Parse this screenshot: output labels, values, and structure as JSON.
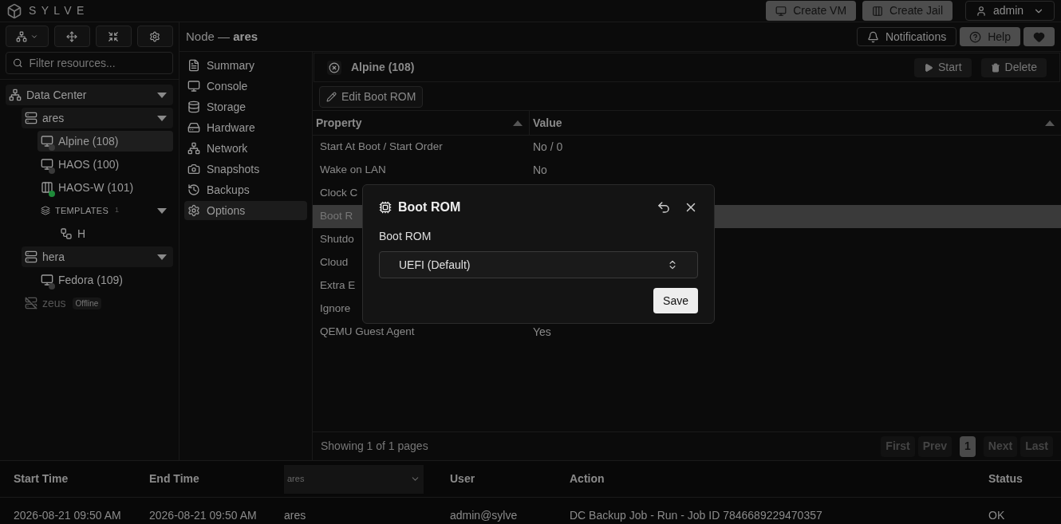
{
  "brand": "SYLVE",
  "header_buttons": [
    {
      "label": "Create VM",
      "kind": "vm"
    },
    {
      "label": "Create Jail",
      "kind": "jail"
    },
    {
      "label": "admin",
      "kind": "user"
    }
  ],
  "search": {
    "placeholder": "Filter resources..."
  },
  "tree": [
    {
      "label": "Data Center",
      "kind": "datacenter",
      "expanded": true,
      "children": [
        {
          "label": "ares",
          "kind": "node",
          "expanded": true,
          "children": [
            {
              "label": "Alpine (108)",
              "kind": "vm",
              "color": "#3a3a3a",
              "selected": true
            },
            {
              "label": "HAOS (100)",
              "kind": "vm",
              "color": "#3a3a3a",
              "selected": false
            },
            {
              "label": "HAOS-W (101)",
              "kind": "jail",
              "color": "#1f8a3a",
              "selected": false
            },
            {
              "label": "TEMPLATES",
              "count": "1",
              "kind": "group",
              "expanded": true,
              "children": [
                {
                  "label": "H",
                  "kind": "template",
                  "selected": false
                }
              ]
            }
          ]
        },
        {
          "label": "hera",
          "kind": "node",
          "expanded": true,
          "children": [
            {
              "label": "Fedora (109)",
              "kind": "vm",
              "color": "#3a3a3a",
              "selected": false
            }
          ]
        },
        {
          "label": "zeus",
          "kind": "offline",
          "badge": "Offline"
        }
      ]
    }
  ],
  "breadcrumb": {
    "prefix": "Node —",
    "node": "ares"
  },
  "top_right_buttons": [
    {
      "label": "Notifications",
      "kind": "bell"
    },
    {
      "label": "Help",
      "kind": "help"
    },
    {
      "kind": "heart"
    }
  ],
  "menu": [
    {
      "label": "Summary",
      "kind": "summary",
      "selected": false
    },
    {
      "label": "Console",
      "kind": "console",
      "selected": false
    },
    {
      "label": "Storage",
      "kind": "storage",
      "selected": false
    },
    {
      "label": "Hardware",
      "kind": "hardware",
      "selected": false
    },
    {
      "label": "Network",
      "kind": "network",
      "selected": false
    },
    {
      "label": "Snapshots",
      "kind": "snapshots",
      "selected": false
    },
    {
      "label": "Backups",
      "kind": "backups",
      "selected": false
    },
    {
      "label": "Options",
      "kind": "options",
      "selected": true
    }
  ],
  "vm_title": "Alpine (108)",
  "vm_actions": [
    {
      "label": "Start",
      "kind": "start"
    },
    {
      "label": "Delete",
      "kind": "delete"
    }
  ],
  "edit_button": "Edit Boot ROM",
  "table": {
    "columns": [
      "Property",
      "Value"
    ],
    "rows": [
      {
        "property": "Start At Boot / Start Order",
        "value": "No / 0",
        "selected": false
      },
      {
        "property": "Wake on LAN",
        "value": "No",
        "selected": false
      },
      {
        "property": "Clock C",
        "selected": false
      },
      {
        "property": "Boot R",
        "selected": true
      },
      {
        "property": "Shutdo",
        "selected": false
      },
      {
        "property": "Cloud",
        "selected": false
      },
      {
        "property": "Extra E",
        "selected": false
      },
      {
        "property": "Ignore",
        "selected": false
      },
      {
        "property": "QEMU Guest Agent",
        "value": "Yes",
        "selected": false
      }
    ]
  },
  "pagination": {
    "info": "Showing 1 of 1 pages",
    "buttons": [
      {
        "label": "First",
        "selected": false
      },
      {
        "label": "Prev",
        "selected": false
      },
      {
        "label": "1",
        "selected": true
      },
      {
        "label": "Next",
        "selected": false
      },
      {
        "label": "Last",
        "selected": false
      }
    ]
  },
  "dialog": {
    "title": "Boot ROM",
    "field_label": "Boot ROM",
    "value": "UEFI (Default)",
    "save": "Save"
  },
  "tasks": {
    "columns": [
      "Start Time",
      "End Time",
      "ares",
      "User",
      "Action",
      "Status"
    ],
    "rows": [
      [
        "2026-08-21 09:50 AM",
        "2026-08-21 09:50 AM",
        "ares",
        "admin@sylve",
        "DC Backup Job - Run - Job ID 7846689229470357",
        "OK"
      ]
    ]
  }
}
